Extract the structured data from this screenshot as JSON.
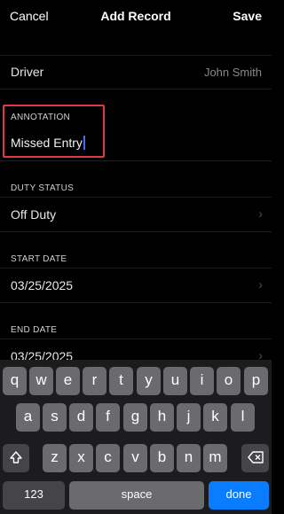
{
  "nav": {
    "cancel": "Cancel",
    "title": "Add Record",
    "save": "Save"
  },
  "driver": {
    "label": "Driver",
    "value": "John Smith"
  },
  "annotation": {
    "label": "ANNOTATION",
    "value": "Missed Entry"
  },
  "duty_status": {
    "label": "DUTY STATUS",
    "value": "Off Duty"
  },
  "start_date": {
    "label": "START DATE",
    "value": "03/25/2025"
  },
  "end_date": {
    "label": "END DATE",
    "value": "03/25/2025"
  },
  "keyboard": {
    "row1": [
      "q",
      "w",
      "e",
      "r",
      "t",
      "y",
      "u",
      "i",
      "o",
      "p"
    ],
    "row2": [
      "a",
      "s",
      "d",
      "f",
      "g",
      "h",
      "j",
      "k",
      "l"
    ],
    "row3": [
      "z",
      "x",
      "c",
      "v",
      "b",
      "n",
      "m"
    ],
    "numbers": "123",
    "space": "space",
    "done": "done",
    "shift_icon": "shift-icon",
    "delete_icon": "delete-icon"
  },
  "colors": {
    "highlight": "#e0393f",
    "accent": "#0a7cff",
    "cursor": "#3a6ff7"
  }
}
